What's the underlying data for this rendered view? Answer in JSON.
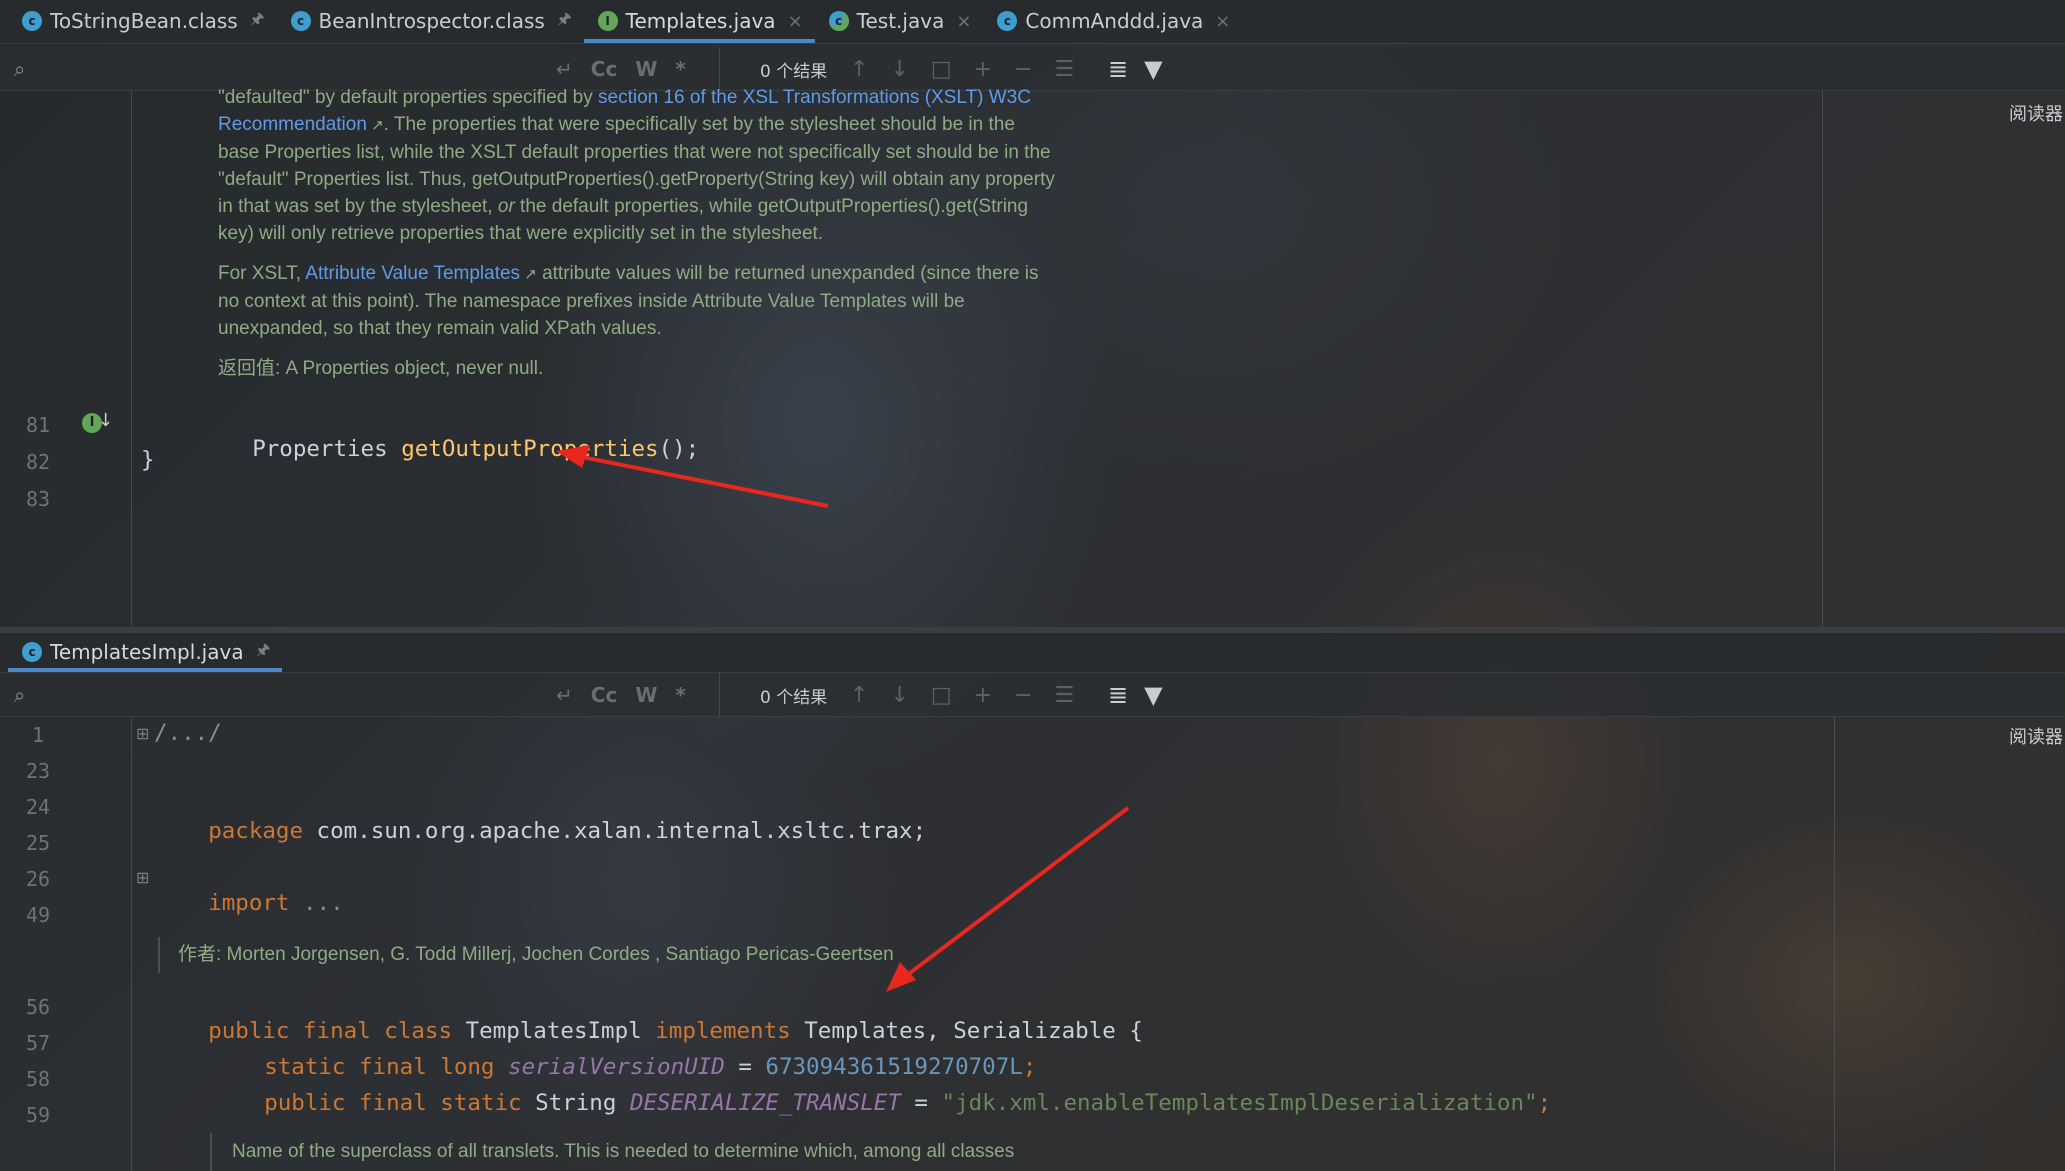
{
  "top_editor": {
    "tabs": [
      {
        "label": "ToStringBean.class",
        "icon": "class-icon",
        "pinned": true
      },
      {
        "label": "BeanIntrospector.class",
        "icon": "class-icon",
        "pinned": true
      },
      {
        "label": "Templates.java",
        "icon": "interface-icon",
        "active": true
      },
      {
        "label": "Test.java",
        "icon": "test-class-icon"
      },
      {
        "label": "CommAnddd.java",
        "icon": "class-icon"
      }
    ],
    "find": {
      "placeholder": "",
      "opt_cc": "Cc",
      "opt_w": "W",
      "opt_regex": "*",
      "result": "0 个结果"
    },
    "reader_label": "阅读器",
    "doc": {
      "p1_l1a": "\"defaulted\" by default properties specified by ",
      "p1_link1": "section 16 of the XSL Transformations (XSLT) W3C",
      "p1_link2": "Recommendation",
      "p1_l2b": ". The properties that were specifically set by the stylesheet should be in the",
      "p1_l3": "base Properties list, while the XSLT default properties that were not specifically set should be in the",
      "p1_l4": "\"default\" Properties list. Thus, getOutputProperties().getProperty(String key) will obtain any property",
      "p1_l5a": "in that was set by the stylesheet, ",
      "p1_l5em": "or",
      "p1_l5b": " the default properties, while getOutputProperties().get(String",
      "p1_l6": "key) will only retrieve properties that were explicitly set in the stylesheet.",
      "p2_l1a": "For XSLT, ",
      "p2_link": "Attribute Value Templates",
      "p2_l1b": " attribute values will be returned unexpanded (since there is",
      "p2_l2": "no context at this point). The namespace prefixes inside Attribute Value Templates will be",
      "p2_l3": "unexpanded, so that they remain valid XPath values.",
      "returns": "返回值: A Properties object, never null."
    },
    "lines": [
      {
        "num": "81",
        "type": "Properties",
        "method": "getOutputProperties",
        "tail": "();"
      },
      {
        "num": "82",
        "text": "}"
      },
      {
        "num": "83",
        "text": ""
      }
    ]
  },
  "bottom_editor": {
    "tab": {
      "label": "TemplatesImpl.java",
      "icon": "class-icon",
      "pinned": true
    },
    "find": {
      "placeholder": "",
      "opt_cc": "Cc",
      "opt_w": "W",
      "opt_regex": "*",
      "result": "0 个结果"
    },
    "reader_label": "阅读器",
    "line_numbers": [
      "1",
      "23",
      "24",
      "25",
      "26",
      "49",
      "56",
      "57",
      "58",
      "59"
    ],
    "folded_header": "/.../",
    "package_kw": "package",
    "package_name": " com.sun.org.apache.xalan.internal.xsltc.trax;",
    "import_kw": "import",
    "import_rest": " ...",
    "author_doc": "作者: Morten Jorgensen, G. Todd Millerj, Jochen Cordes , Santiago Pericas-Geertsen",
    "class_decl": {
      "kw": "public final class",
      "name": " TemplatesImpl ",
      "impl_kw": "implements",
      "ifaces": " Templates, Serializable {"
    },
    "serial": {
      "kw": "static final long",
      "field": "serialVersionUID",
      "eq": " = ",
      "value": "673094361519270707L",
      "end": ";"
    },
    "translet": {
      "kw": "public final static",
      "type": " String ",
      "field": "DESERIALIZE_TRANSLET",
      "eq": " = ",
      "value": "\"jdk.xml.enableTemplatesImplDeserialization\"",
      "end": ";"
    },
    "bottom_doc": "Name of the superclass of all translets. This is needed to determine which, among all classes"
  },
  "colors": {
    "keyword": "#cc7832",
    "method": "#ffc66d",
    "string": "#6a8759",
    "number": "#6897bb",
    "field": "#9876aa",
    "link": "#5f9be6",
    "annotation_arrow": "#e8271f"
  }
}
